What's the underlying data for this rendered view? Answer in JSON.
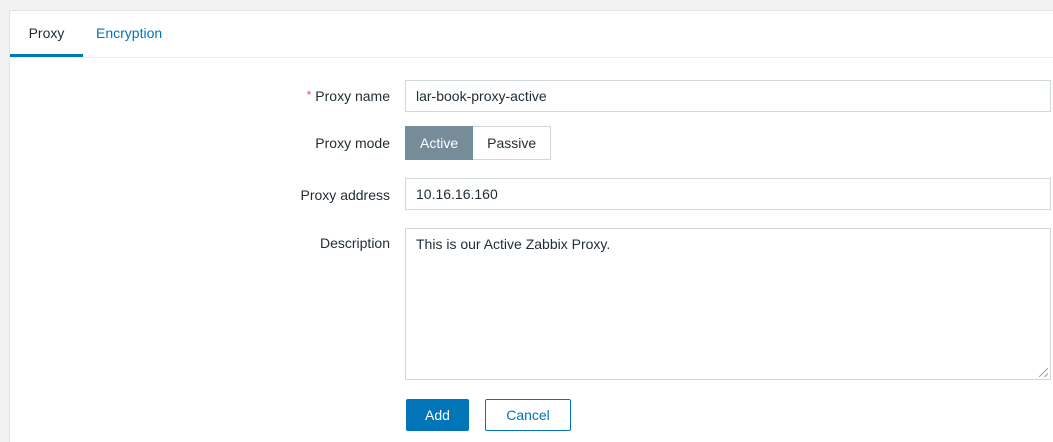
{
  "tabs": [
    {
      "label": "Proxy",
      "active": true
    },
    {
      "label": "Encryption",
      "active": false
    }
  ],
  "form": {
    "proxy_name": {
      "required_mark": "*",
      "label": "Proxy name",
      "value": "lar-book-proxy-active"
    },
    "proxy_mode": {
      "label": "Proxy mode",
      "options": [
        "Active",
        "Passive"
      ],
      "selected": "Active"
    },
    "proxy_address": {
      "label": "Proxy address",
      "value": "10.16.16.160"
    },
    "description": {
      "label": "Description",
      "value": "This is our Active Zabbix Proxy."
    }
  },
  "buttons": {
    "add": "Add",
    "cancel": "Cancel"
  },
  "colors": {
    "accent": "#0275b8",
    "toggle_active_bg": "#768d99",
    "required": "#e45959"
  }
}
